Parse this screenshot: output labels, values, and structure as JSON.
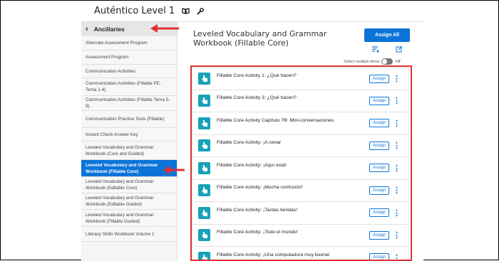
{
  "topbar": {
    "title": "Auténtico Level 1"
  },
  "sidebar": {
    "header": "Ancillaries",
    "items": [
      {
        "label": "Alternate Assessment Program",
        "active": false
      },
      {
        "label": "Assessment Program",
        "active": false
      },
      {
        "label": "Communication Activities",
        "active": false
      },
      {
        "label": "Communication Activities (Fillable PE, Tema 1-4)",
        "active": false
      },
      {
        "label": "Communication Activities (Fillable Tema 5-9)",
        "active": false
      },
      {
        "label": "Communication Practice Tests (Fillable)",
        "active": false
      },
      {
        "label": "Instant Check Answer Key",
        "active": false
      },
      {
        "label": "Leveled Vocabulary and Grammar Workbook (Core and Guided)",
        "active": false
      },
      {
        "label": "Leveled Vocabulary and Grammar Workbook (Fillable Core)",
        "active": true
      },
      {
        "label": "Leveled Vocabulary and Grammar Workbook (Editable Core)",
        "active": false
      },
      {
        "label": "Leveled Vocabulary and Grammar Workbook (Editable Guided)",
        "active": false
      },
      {
        "label": "Leveled Vocabulary and Grammar Workbook (Fillable Guided)",
        "active": false
      },
      {
        "label": "Literacy Skills Workbook Volume 1",
        "active": false
      }
    ]
  },
  "main": {
    "title": "Leveled Vocabulary and Grammar Workbook (Fillable Core)",
    "assign_all_label": "Assign All",
    "select_multiple_label": "Select multiple items",
    "toggle_state": "Off",
    "assign_label": "Assign",
    "activities": [
      "Fillable Core Activity 1: ¿Qué hacen?",
      "Fillable Core Activity 3: ¿Qué hacen?",
      "Fillable Core Activity Capítulo 7B: Mini-conversaciones",
      "Fillable Core Activity: ¡A cenar",
      "Fillable Core Activity: ¡Aquí está!",
      "Fillable Core Activity: ¡Mucha confusión!",
      "Fillable Core Activity: ¡Tantas tiendas!",
      "Fillable Core Activity: ¡Todo el mundo!",
      "Fillable Core Activity: ¡Una computadora muy buena!"
    ]
  },
  "colors": {
    "accent": "#0b74d8",
    "activity_icon": "#17a2b8",
    "annotation": "#e03131"
  }
}
